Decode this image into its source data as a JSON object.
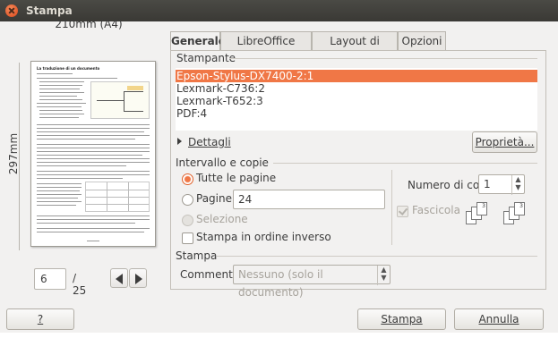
{
  "window": {
    "title": "Stampa"
  },
  "preview": {
    "paper_width_label": "210mm (A4)",
    "paper_height_label": "297mm",
    "doc_heading": "La traduzione di un documento",
    "current_page": "6",
    "total_pages": "/ 25"
  },
  "tabs": [
    {
      "label": "Generale",
      "active": true
    },
    {
      "label": "LibreOffice Writer",
      "active": false
    },
    {
      "label": "Layout di pagina",
      "active": false
    },
    {
      "label": "Opzioni",
      "active": false
    }
  ],
  "printer": {
    "section_label": "Stampante",
    "printers": [
      "Epson-Stylus-DX7400-2:1",
      "Lexmark-C736:2",
      "Lexmark-T652:3",
      "PDF:4"
    ],
    "selected_index": 0,
    "details_label": "Dettagli",
    "properties_button": "Proprietà..."
  },
  "range": {
    "section_label": "Intervallo e copie",
    "all_pages_label": "Tutte le pagine",
    "pages_label": "Pagine",
    "pages_value": "24",
    "selection_label": "Selezione",
    "reverse_label": "Stampa in ordine inverso",
    "copies_label": "Numero di copie",
    "copies_value": "1",
    "collate_label": "Fascicola"
  },
  "print_section": {
    "section_label": "Stampa",
    "comments_label": "Commenti",
    "comments_value": "Nessuno (solo il documento)"
  },
  "buttons": {
    "help": "?",
    "print": "Stampa",
    "cancel": "Annulla"
  },
  "colors": {
    "accent": "#f07746",
    "title_bar": "#3c3b37"
  }
}
